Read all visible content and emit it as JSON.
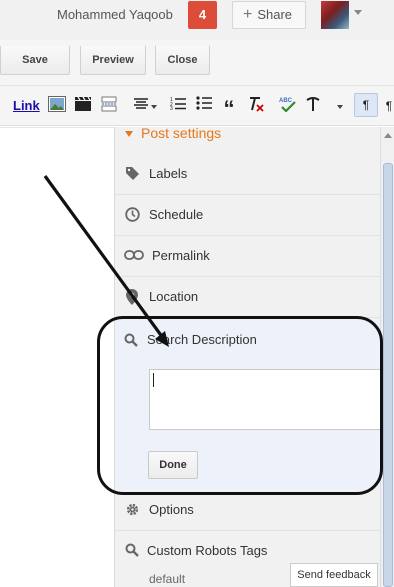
{
  "topbar": {
    "user_name": "Mohammed Yaqoob",
    "notification_count": "4",
    "share_label": "Share"
  },
  "actions": {
    "save": "Save",
    "preview": "Preview",
    "close": "Close"
  },
  "toolbar": {
    "link": "Link",
    "ltr": "¶",
    "rtl": "¶"
  },
  "panel": {
    "title": "Post settings",
    "labels": "Labels",
    "schedule": "Schedule",
    "permalink": "Permalink",
    "location": "Location",
    "search_description": "Search Description",
    "search_description_value": "",
    "done": "Done",
    "options": "Options",
    "custom_robots": "Custom Robots Tags",
    "custom_robots_value": "default"
  },
  "feedback": "Send feedback",
  "colors": {
    "accent": "#e8771a",
    "badge": "#dd4b39",
    "link": "#1a0dab",
    "search_area": "#ecf1fa"
  },
  "icons": [
    "plus-icon",
    "avatar",
    "link-icon",
    "image-icon",
    "video-icon",
    "jump-break-icon",
    "align-icon",
    "numbered-list-icon",
    "bullet-list-icon",
    "quote-icon",
    "clear-format-icon",
    "spellcheck-icon",
    "input-tools-icon",
    "ltr-icon",
    "rtl-icon",
    "tag-icon",
    "clock-icon",
    "chain-icon",
    "pin-icon",
    "magnifier-icon",
    "gear-icon"
  ]
}
